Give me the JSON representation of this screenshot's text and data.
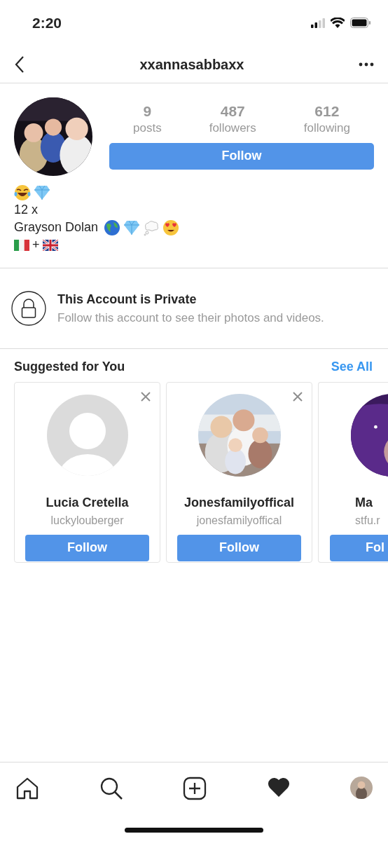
{
  "status_bar": {
    "time": "2:20"
  },
  "header": {
    "username": "xxannasabbaxx"
  },
  "profile": {
    "stats": [
      {
        "value": "9",
        "label": "posts"
      },
      {
        "value": "487",
        "label": "followers"
      },
      {
        "value": "612",
        "label": "following"
      }
    ],
    "follow_button": "Follow",
    "bio": [
      {
        "kind": "emoji"
      },
      {
        "kind": "text",
        "text": "12 x"
      },
      {
        "kind": "name_emoji",
        "text": "Grayson Dolan"
      },
      {
        "kind": "flags",
        "text": "+"
      }
    ]
  },
  "private_notice": {
    "title": "This Account is Private",
    "message": "Follow this account to see their photos and videos."
  },
  "suggestions": {
    "title": "Suggested for You",
    "see_all": "See All",
    "cards": [
      {
        "kind": "placeholder",
        "name": "Lucia Cretella",
        "username": "luckylouberger",
        "button": "Follow",
        "dismissable": true
      },
      {
        "kind": "picture",
        "name": "Jonesfamilyoffical",
        "username": "jonesfamilyoffical",
        "button": "Follow",
        "dismissable": true
      },
      {
        "kind": "picture",
        "name": "Ma",
        "username": "stfu.r",
        "button": "Fol",
        "dismissable": false
      }
    ]
  }
}
